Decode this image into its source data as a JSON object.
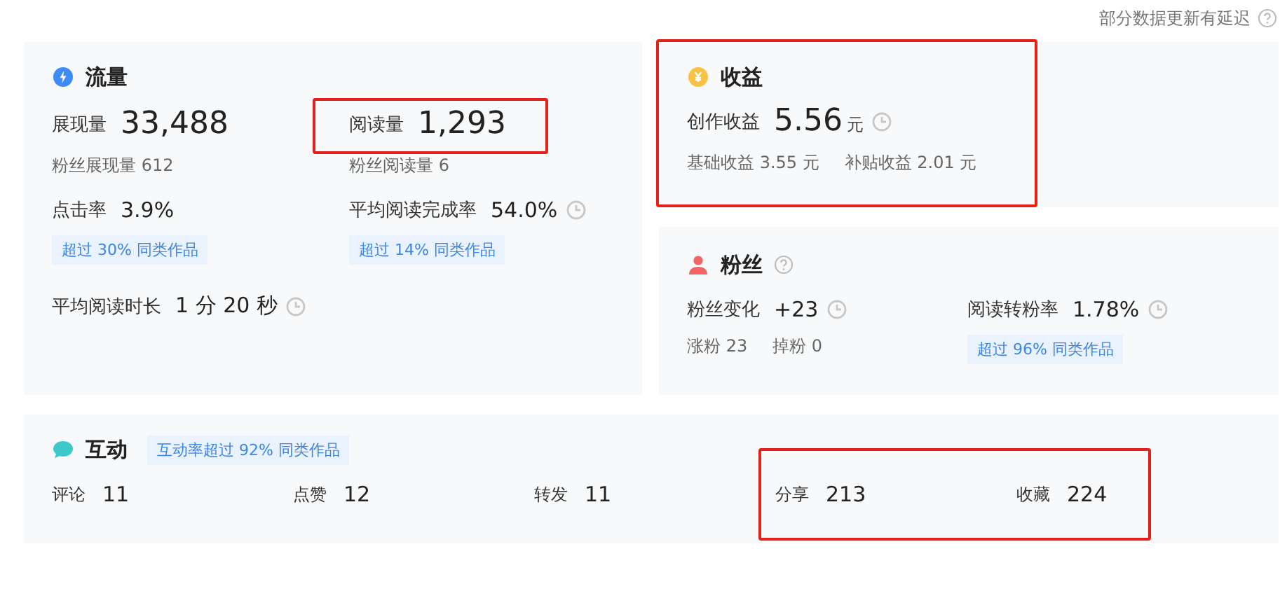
{
  "notice": {
    "text": "部分数据更新有延迟",
    "help": true
  },
  "traffic": {
    "title": "流量",
    "highlighted": false,
    "metrics": [
      {
        "kind": "large",
        "label": "展现量",
        "value": "33,488",
        "subs": [
          "粉丝展现量 612"
        ],
        "clock": false,
        "highlighted": false
      },
      {
        "kind": "large",
        "label": "阅读量",
        "value": "1,293",
        "subs": [
          "粉丝阅读量 6"
        ],
        "clock": false,
        "highlighted": true
      },
      {
        "kind": "normal",
        "label": "点击率",
        "value": "3.9%",
        "badge": "超过 30% 同类作品",
        "clock": false,
        "highlighted": false
      },
      {
        "kind": "normal",
        "label": "平均阅读完成率",
        "value": "54.0%",
        "badge": "超过 14% 同类作品",
        "clock": true,
        "highlighted": false
      },
      {
        "kind": "normal",
        "label": "平均阅读时长",
        "value": "1 分 20 秒",
        "clock": true,
        "highlighted": false
      }
    ]
  },
  "income": {
    "title": "收益",
    "highlighted": true,
    "metrics": [
      {
        "kind": "large",
        "label": "创作收益",
        "value": "5.56",
        "unit": "元",
        "subs": [
          "基础收益 3.55 元",
          "补贴收益 2.01 元"
        ],
        "clock": true,
        "highlighted": false
      }
    ]
  },
  "fans": {
    "title": "粉丝",
    "help": true,
    "highlighted": false,
    "metrics": [
      {
        "kind": "normal",
        "label": "粉丝变化",
        "value": "+23",
        "subs": [
          "涨粉 23",
          "掉粉 0"
        ],
        "clock": true,
        "highlighted": false
      },
      {
        "kind": "normal",
        "label": "阅读转粉率",
        "value": "1.78%",
        "badge": "超过 96% 同类作品",
        "clock": true,
        "highlighted": false
      }
    ]
  },
  "interaction": {
    "title": "互动",
    "badge": "互动率超过 92% 同类作品",
    "groups": [
      {
        "highlighted": false,
        "items": [
          {
            "label": "评论",
            "value": "11"
          },
          {
            "label": "点赞",
            "value": "12"
          },
          {
            "label": "转发",
            "value": "11"
          }
        ]
      },
      {
        "highlighted": true,
        "items": [
          {
            "label": "分享",
            "value": "213"
          },
          {
            "label": "收藏",
            "value": "224"
          }
        ]
      }
    ]
  }
}
